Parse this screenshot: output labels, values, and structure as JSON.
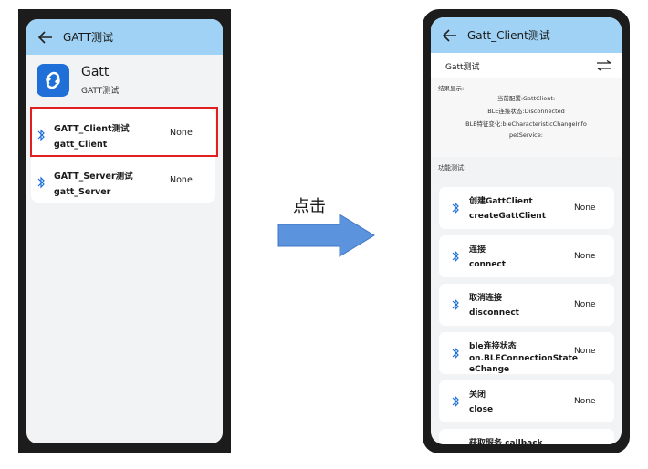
{
  "left": {
    "title": "GATT测试",
    "app_name": "Gatt",
    "app_subtitle": "GATT测试",
    "items": [
      {
        "title": "GATT_Client测试",
        "subtitle": "gatt_Client",
        "status": "None"
      },
      {
        "title": "GATT_Server测试",
        "subtitle": "gatt_Server",
        "status": "None"
      }
    ]
  },
  "arrow": {
    "label": "点击"
  },
  "right": {
    "title": "Gatt_Client测试",
    "subbar_title": "Gatt测试",
    "result": {
      "label": "结果显示:",
      "lines": [
        "当前配置:GattClient:",
        "BLE连接状态:Disconnected",
        "BLE特征变化:bleCharacteristicChangeInfo",
        "petService:"
      ]
    },
    "func_label": "功能测试:",
    "items": [
      {
        "title": "创建GattClient",
        "subtitle": "createGattClient",
        "status": "None"
      },
      {
        "title": "连接",
        "subtitle": "connect",
        "status": "None"
      },
      {
        "title": "取消连接",
        "subtitle": "disconnect",
        "status": "None"
      },
      {
        "title": "ble连接状态",
        "subtitle": "on.BLEConnectionState",
        "subtitle2": "eChange",
        "status": "None"
      },
      {
        "title": "关闭",
        "subtitle": "close",
        "status": "None"
      },
      {
        "title": "获取服务 callback",
        "subtitle": "",
        "status": ""
      }
    ]
  },
  "colors": {
    "titlebar": "#9fd2f4",
    "highlight": "#e02020",
    "arrow": "#5b93dd",
    "bluetooth": "#1e6fd8"
  }
}
